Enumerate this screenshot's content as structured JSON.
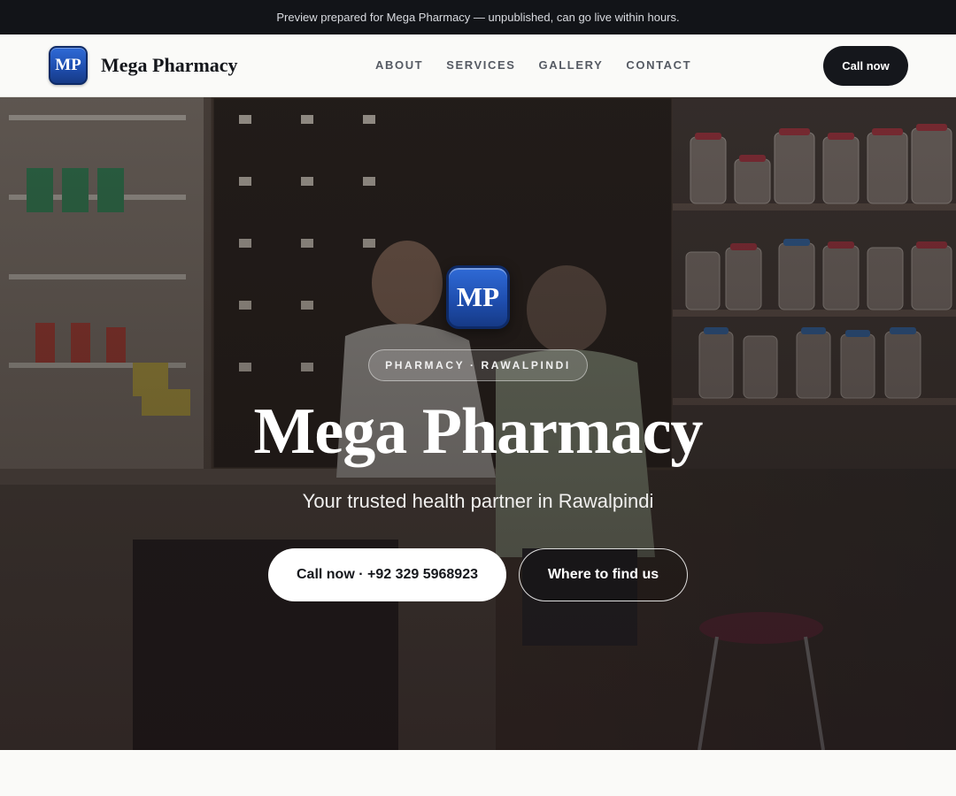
{
  "announcement": "Preview prepared for Mega Pharmacy — unpublished, can go live within hours.",
  "header": {
    "logo_text": "MP",
    "brand_name": "Mega Pharmacy",
    "nav": [
      "ABOUT",
      "SERVICES",
      "GALLERY",
      "CONTACT"
    ],
    "cta_label": "Call now"
  },
  "hero": {
    "logo_text": "MP",
    "badge": "PHARMACY · RAWALPINDI",
    "title": "Mega Pharmacy",
    "subtitle": "Your trusted health partner in Rawalpindi",
    "primary_cta": "Call now · +92 329 5968923",
    "secondary_cta": "Where to find us",
    "background_image": "pharmacy-interior-photo"
  },
  "colors": {
    "dark": "#15171c",
    "logo_blue": "#1f4fb0",
    "page_bg": "#fafaf8"
  }
}
